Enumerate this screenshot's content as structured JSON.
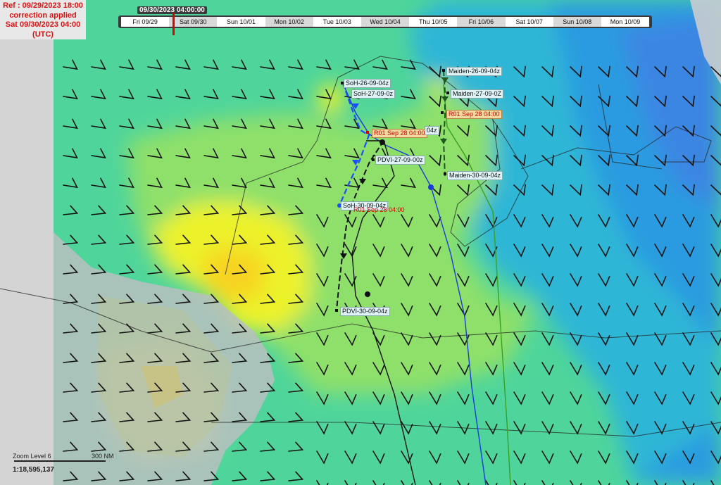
{
  "reference": {
    "line1": "Ref : 09/29/2023 18:00",
    "line2": "correction applied",
    "line3": "Sat 09/30/2023 04:00",
    "line4": "(UTC)"
  },
  "timeline": {
    "current_time": "09/30/2023 04:00:00",
    "days": [
      "Fri 09/29",
      "Sat 09/30",
      "Sun 10/01",
      "Mon 10/02",
      "Tue 10/03",
      "Wed 10/04",
      "Thu 10/05",
      "Fri 10/06",
      "Sat 10/07",
      "Sun 10/08",
      "Mon 10/09"
    ]
  },
  "labels": {
    "soh_26": "SoH-26-09-04z",
    "soh_27": "SoH-27-09-0z",
    "r01_28a": "R01 Sep 28 04:00",
    "pdvi_04z": "04z",
    "pdvi_27": "PDVI-27-09-00z",
    "soh_30": "SoH-30-09-04z",
    "r01_30": "R01 Sep 28 04:00",
    "pdvi_30": "PDVI-30-09-04z",
    "maiden_26": "Maiden-26-09-04z",
    "maiden_27": "Maiden-27-09-0Z",
    "r01_28b": "R01 Sep 28 04:00",
    "maiden_30": "Maiden-30-09-04z"
  },
  "scale": {
    "zoom_label": "Zoom Level 6",
    "max_distance": "300 NM",
    "ratio": "1:18,595,137"
  },
  "colors": {
    "route_soh": "#1a4fff",
    "route_pdvi": "#111111",
    "route_maiden": "#1e5a1e",
    "route_blue": "#1a3adf",
    "route_green": "#3aa020",
    "land": "#c9c9c9",
    "current_time_marker": "#e00000"
  }
}
